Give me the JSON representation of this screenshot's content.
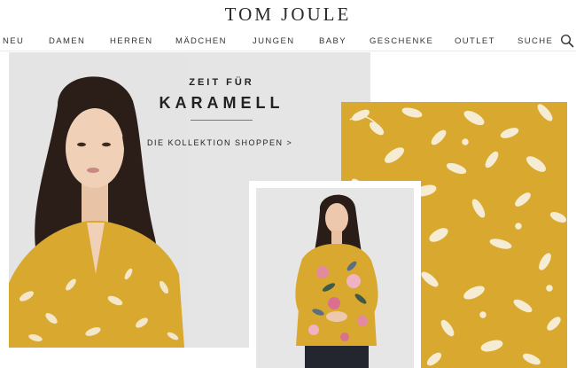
{
  "brand": {
    "logo": "TOM JOULE"
  },
  "nav": {
    "items": [
      "NEU",
      "DAMEN",
      "HERREN",
      "MÄDCHEN",
      "JUNGEN",
      "BABY",
      "GESCHENKE",
      "OUTLET",
      "SUCHE"
    ],
    "search_icon": "search-icon"
  },
  "hero": {
    "kicker": "ZEIT FÜR",
    "headline": "KARAMELL",
    "cta": "DIE KOLLEKTION SHOPPEN >"
  },
  "colors": {
    "mustard": "#d9a92f",
    "hero_bg": "#e5e5e5",
    "text": "#222222"
  }
}
